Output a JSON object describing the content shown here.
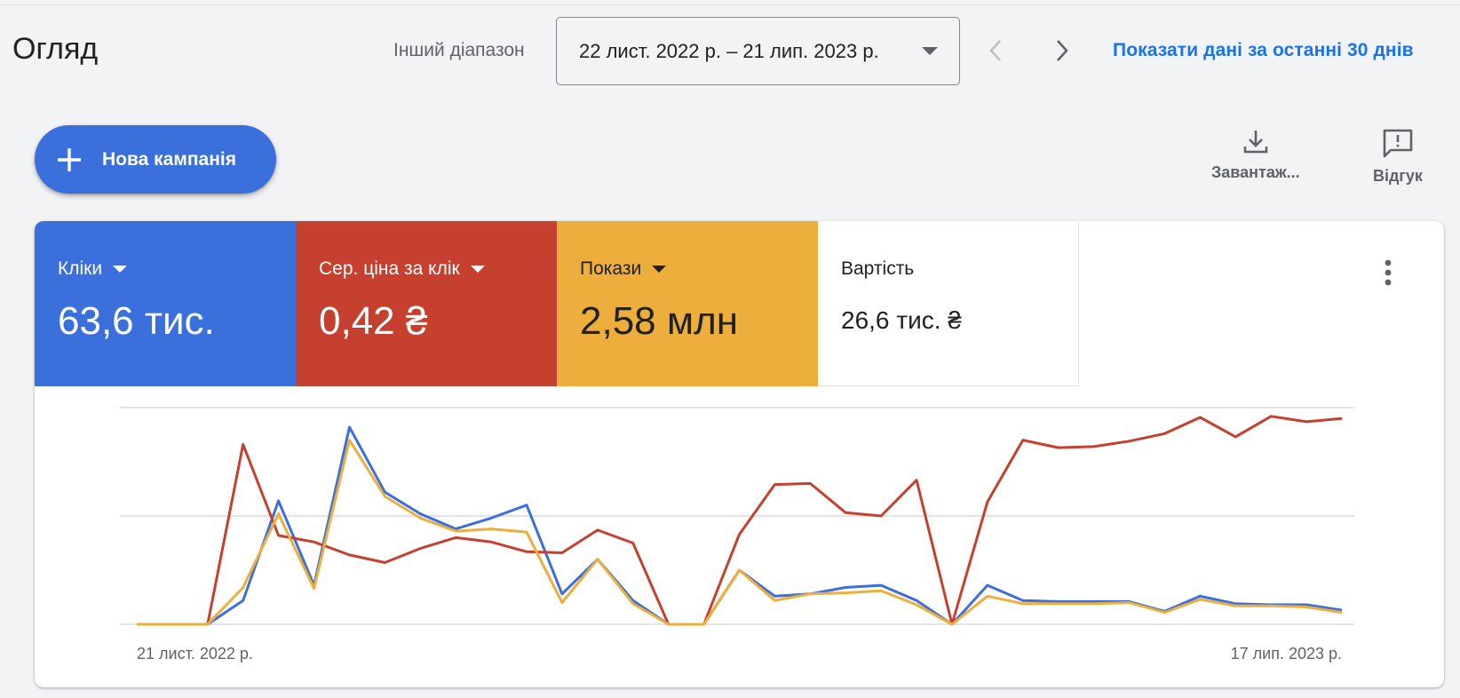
{
  "header": {
    "title": "Огляд",
    "range_label": "Інший діапазон",
    "date_range": "22 лист. 2022 р. – 21 лип. 2023 р.",
    "last_30_label": "Показати дані за останні 30 днів"
  },
  "actions": {
    "new_campaign_label": "Нова кампанія",
    "download_label": "Завантаж...",
    "feedback_label": "Відгук"
  },
  "metrics": [
    {
      "label": "Кліки",
      "value": "63,6 тис.",
      "color": "#3b6fdb",
      "text_color": "#ffffff",
      "dropdown": true
    },
    {
      "label": "Сер. ціна за клік",
      "value": "0,42 ₴",
      "color": "#c5402f",
      "text_color": "#ffffff",
      "dropdown": true
    },
    {
      "label": "Покази",
      "value": "2,58 млн",
      "color": "#edae3c",
      "text_color": "#202124",
      "dropdown": true
    },
    {
      "label": "Вартість",
      "value": "26,6 тис. ₴",
      "color": "#ffffff",
      "text_color": "#202124",
      "dropdown": false
    }
  ],
  "chart_data": {
    "type": "line",
    "x_start_label": "21 лист. 2022 р.",
    "x_end_label": "17 лип. 2023 р.",
    "grid": true,
    "ylim": [
      0,
      100
    ],
    "series": [
      {
        "color": "#3b6fdb",
        "values": [
          0,
          0,
          0,
          11,
          57,
          18,
          91,
          61,
          51,
          44,
          49,
          55,
          14,
          30,
          11,
          0,
          0,
          25,
          13,
          14,
          17,
          18,
          11,
          0,
          18,
          11,
          10.5,
          10.5,
          10.5,
          6,
          13,
          9.5,
          9,
          9,
          6.5
        ]
      },
      {
        "color": "#c5402f",
        "values": [
          0,
          0,
          0,
          83,
          41,
          38,
          32,
          28.5,
          35,
          40,
          38,
          33.5,
          33,
          43.5,
          37.5,
          0,
          0,
          41.5,
          64.5,
          65,
          51.5,
          50,
          66.5,
          0,
          56.5,
          85,
          81.5,
          82,
          84.5,
          88,
          95.5,
          86.5,
          96,
          93.5,
          95
        ]
      },
      {
        "color": "#edae3c",
        "values": [
          0,
          0,
          0,
          17,
          51,
          16.5,
          85,
          59,
          49,
          43,
          44,
          42.5,
          10,
          30,
          9.5,
          0,
          0,
          25,
          11,
          14,
          14.5,
          15.5,
          9,
          0,
          13,
          9.5,
          9.5,
          9.5,
          10,
          5.5,
          11.5,
          8.5,
          8.5,
          8,
          5.5
        ]
      }
    ]
  }
}
